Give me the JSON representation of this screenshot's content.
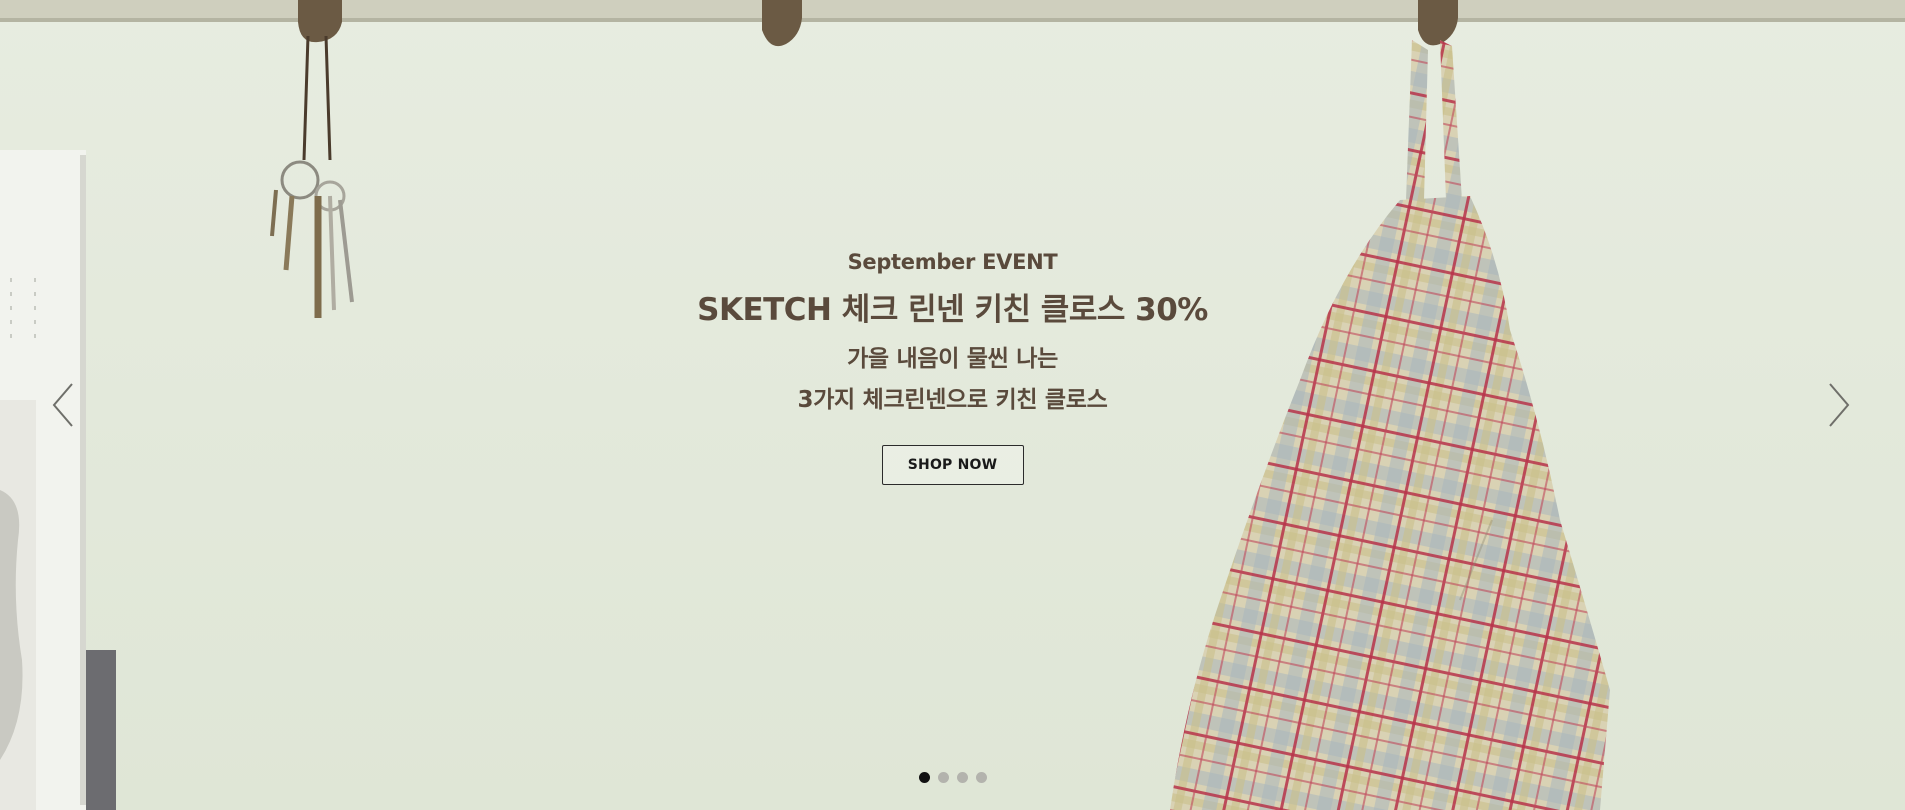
{
  "hero": {
    "eyebrow": "September EVENT",
    "headline": "SKETCH 체크 린넨 키친 클로스 30%",
    "line1": "가을 내음이 물씬 나는",
    "line2": "3가지 체크린넨으로 키친 클로스",
    "cta_label": "SHOP NOW"
  },
  "controls": {
    "prev_icon": "chevron-left-icon",
    "next_icon": "chevron-right-icon"
  },
  "pagination": {
    "total": 4,
    "active_index": 0
  },
  "colors": {
    "text": "#5a4a3c",
    "background": "#e3e9dc",
    "button_border": "#2b2b2b",
    "dot_active": "#111111",
    "dot_inactive": "#b3b3ad"
  }
}
